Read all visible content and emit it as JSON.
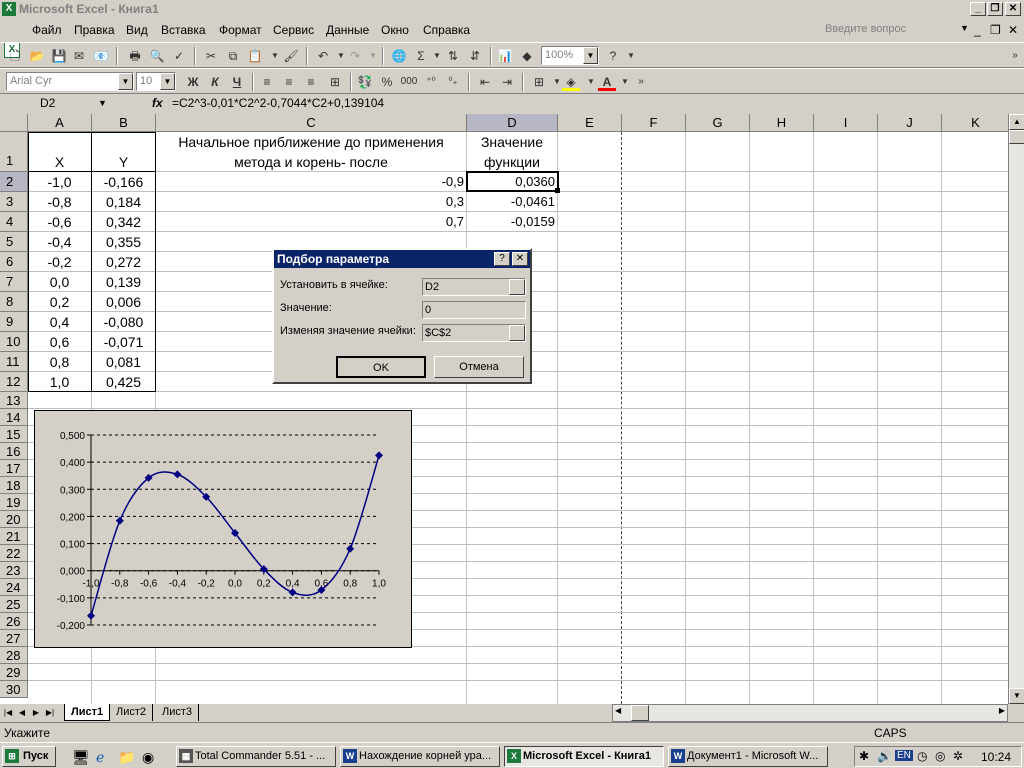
{
  "window": {
    "title": "Microsoft Excel - Книга1"
  },
  "menu": {
    "items": [
      "Файл",
      "Правка",
      "Вид",
      "Вставка",
      "Формат",
      "Сервис",
      "Данные",
      "Окно",
      "Справка"
    ],
    "help_placeholder": "Введите вопрос"
  },
  "toolbar": {
    "zoom": "100%",
    "font": "Arial Cyr",
    "size": "10",
    "bold": "Ж",
    "italic": "К",
    "underline": "Ч",
    "percent": "%",
    "thousands": "000"
  },
  "formula_bar": {
    "cell_ref": "D2",
    "fx": "fx",
    "formula": "=C2^3-0,01*C2^2-0,7044*C2+0,139104"
  },
  "columns": [
    "A",
    "B",
    "C",
    "D",
    "E",
    "F",
    "G",
    "H",
    "I",
    "J",
    "K"
  ],
  "rows": [
    "1",
    "2",
    "3",
    "4",
    "5",
    "6",
    "7",
    "8",
    "9",
    "10",
    "11",
    "12",
    "13",
    "14",
    "15",
    "16",
    "17",
    "18",
    "19",
    "20",
    "21",
    "22",
    "23",
    "24",
    "25",
    "26",
    "27",
    "28",
    "29",
    "30"
  ],
  "sheet": {
    "header_x": "X",
    "header_y": "Y",
    "header_c": "Начальное приближение до применения метода и корень- после",
    "header_d": "Значение функции",
    "x_values": [
      "-1,0",
      "-0,8",
      "-0,6",
      "-0,4",
      "-0,2",
      "0,0",
      "0,2",
      "0,4",
      "0,6",
      "0,8",
      "1,0"
    ],
    "y_values": [
      "-0,166",
      "0,184",
      "0,342",
      "0,355",
      "0,272",
      "0,139",
      "0,006",
      "-0,080",
      "-0,071",
      "0,081",
      "0,425"
    ],
    "c_values": [
      "-0,9",
      "0,3",
      "0,7"
    ],
    "d_values": [
      "0,0360",
      "-0,0461",
      "-0,0159"
    ]
  },
  "chart_data": {
    "type": "scatter",
    "x": [
      -1.0,
      -0.8,
      -0.6,
      -0.4,
      -0.2,
      0.0,
      0.2,
      0.4,
      0.6,
      0.8,
      1.0
    ],
    "y": [
      -0.166,
      0.184,
      0.342,
      0.355,
      0.272,
      0.139,
      0.006,
      -0.08,
      -0.071,
      0.081,
      0.425
    ],
    "x_ticks": [
      "-1,0",
      "-0,8",
      "-0,6",
      "-0,4",
      "-0,2",
      "0,0",
      "0,2",
      "0,4",
      "0,6",
      "0,8",
      "1,0"
    ],
    "y_ticks": [
      "0,500",
      "0,400",
      "0,300",
      "0,200",
      "0,100",
      "0,000",
      "-0,100",
      "-0,200"
    ],
    "xlim": [
      -1.0,
      1.0
    ],
    "ylim": [
      -0.2,
      0.5
    ],
    "grid": true,
    "line_style": "smoothed line with diamond markers",
    "color": "#000080"
  },
  "dialog": {
    "title": "Подбор параметра",
    "label_set_cell": "Установить в ячейке:",
    "set_cell": "D2",
    "label_value": "Значение:",
    "value": "0",
    "label_changing": "Изменяя значение ячейки:",
    "changing_cell": "$C$2",
    "ok": "OK",
    "cancel": "Отмена"
  },
  "sheet_tabs": [
    "Лист1",
    "Лист2",
    "Лист3"
  ],
  "status": {
    "left": "Укажите",
    "caps": "CAPS"
  },
  "taskbar": {
    "start": "Пуск",
    "tasks": [
      "Total Commander 5.51 - ...",
      "Нахождение корней ура...",
      "Microsoft Excel - Книга1",
      "Документ1 - Microsoft W..."
    ],
    "lang": "EN",
    "clock": "10:24"
  }
}
